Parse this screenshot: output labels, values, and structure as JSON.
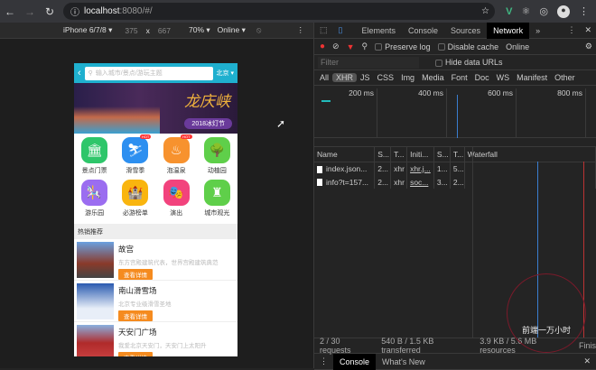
{
  "browser": {
    "url_host": "localhost",
    "url_rest": ":8080/#/"
  },
  "device_toolbar": {
    "device": "iPhone 6/7/8 ▾",
    "width": "375",
    "x": "x",
    "height": "667",
    "zoom": "70% ▾",
    "network": "Online ▾"
  },
  "phone": {
    "search_placeholder": "输入城市/景点/游玩主题",
    "city": "北京 ▾",
    "banner": {
      "title": "龙庆峡",
      "subtitle": "2018冰灯节"
    },
    "icons": [
      {
        "label": "景点门票",
        "color": "#2ec66a",
        "glyph": "🏛",
        "hot": ""
      },
      {
        "label": "滑雪季",
        "color": "#2d8ff0",
        "glyph": "⛷",
        "hot": "HOT"
      },
      {
        "label": "泡温泉",
        "color": "#f7922e",
        "glyph": "♨",
        "hot": "HOT"
      },
      {
        "label": "动植园",
        "color": "#5fcf4a",
        "glyph": "🌳",
        "hot": ""
      },
      {
        "label": "游乐园",
        "color": "#9b6df0",
        "glyph": "🎠",
        "hot": ""
      },
      {
        "label": "必游榜单",
        "color": "#f9b50f",
        "glyph": "🏰",
        "hot": ""
      },
      {
        "label": "演出",
        "color": "#f2437d",
        "glyph": "🎭",
        "hot": ""
      },
      {
        "label": "城市观光",
        "color": "#5fcf4a",
        "glyph": "♜",
        "hot": ""
      }
    ],
    "section_title": "热销推荐",
    "items": [
      {
        "title": "故宫",
        "desc": "东方宫殿建筑代表，世界宫殿建筑典范",
        "button": "查看详情"
      },
      {
        "title": "南山滑雪场",
        "desc": "北京专业级滑雪圣地",
        "button": "查看详情"
      },
      {
        "title": "天安门广场",
        "desc": "我爱北京天安门，天安门上太阳升",
        "button": "查看详情"
      }
    ]
  },
  "devtools": {
    "tabs": [
      "Elements",
      "Console",
      "Sources",
      "Network",
      "»"
    ],
    "active_tab": "Network",
    "preserve_log": "Preserve log",
    "disable_cache": "Disable cache",
    "throttle": "Online",
    "filter_placeholder": "Filter",
    "hide_data_urls": "Hide data URLs",
    "filter_types": [
      "All",
      "XHR",
      "JS",
      "CSS",
      "Img",
      "Media",
      "Font",
      "Doc",
      "WS",
      "Manifest",
      "Other"
    ],
    "timeline_ticks": [
      "200 ms",
      "400 ms",
      "600 ms",
      "800 ms"
    ],
    "columns": [
      "Name",
      "S...",
      "T...",
      "Initi...",
      "S...",
      "T...",
      "Waterfall"
    ],
    "rows": [
      [
        "index.json...",
        "2...",
        "xhr",
        "xhr.j...",
        "1...",
        "5..."
      ],
      [
        "info?t=157...",
        "2...",
        "xhr",
        "soc...",
        "3...",
        "2..."
      ]
    ],
    "status": {
      "requests": "2 / 30 requests",
      "transferred": "540 B / 1.5 KB transferred",
      "resources": "3.9 KB / 5.6 MB resources",
      "finish": "Finis"
    },
    "drawer_tabs": [
      "Console",
      "What's New"
    ],
    "watermark": "前端一万小时"
  }
}
